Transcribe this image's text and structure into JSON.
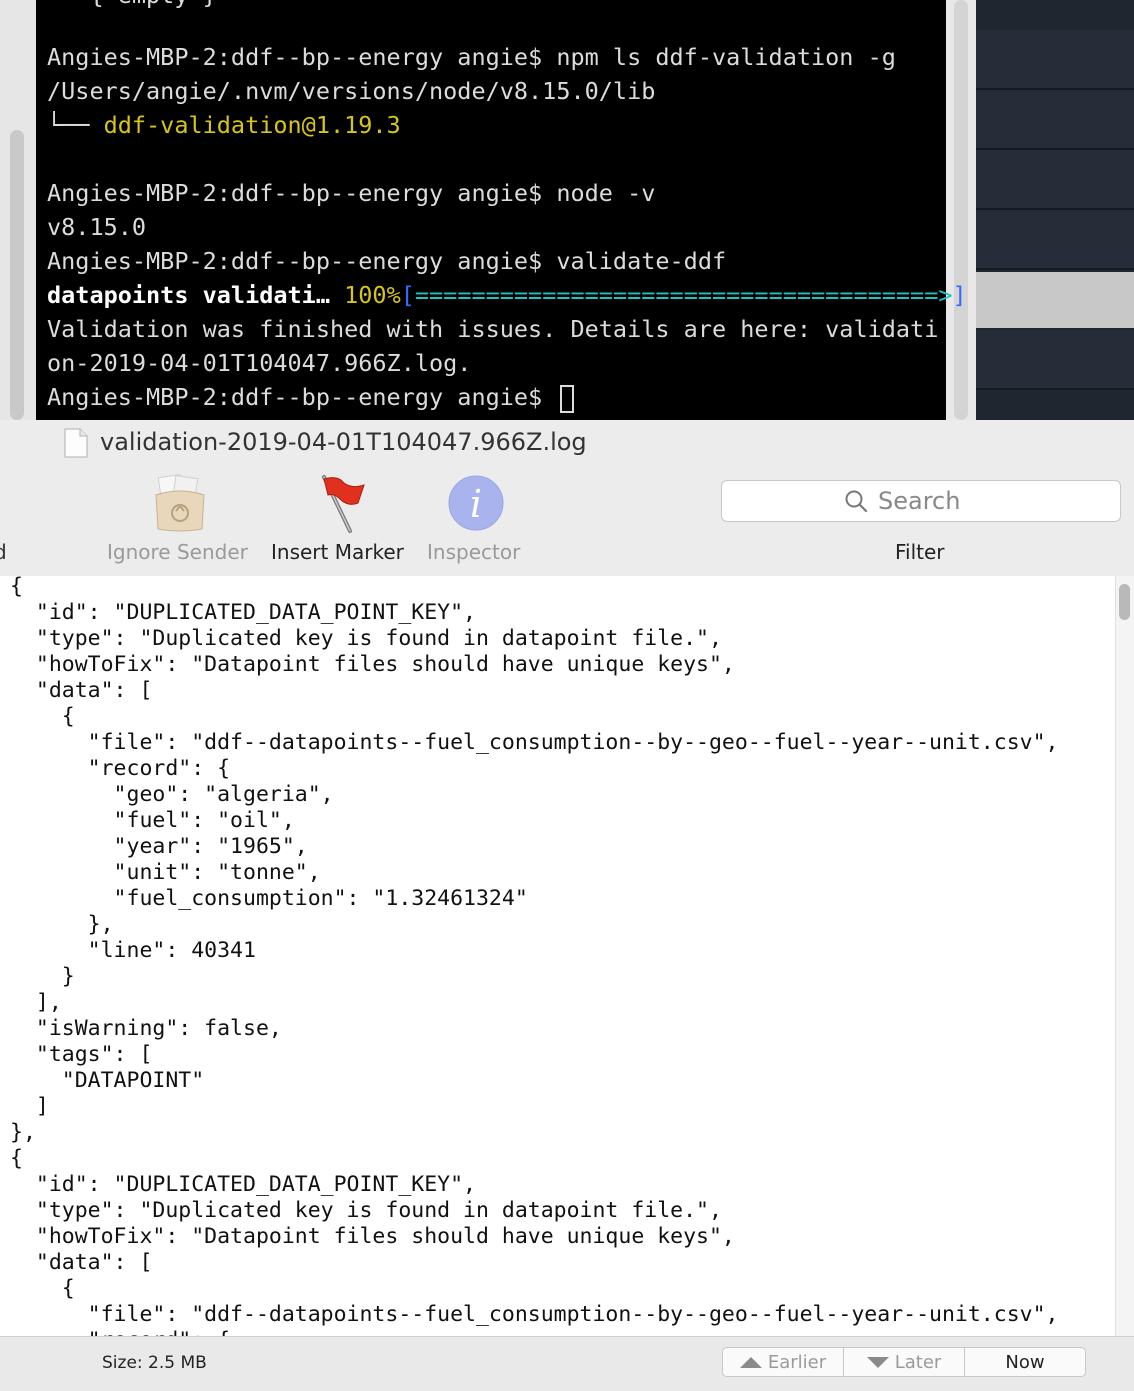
{
  "terminal": {
    "lines": [
      {
        "text": "   { empty }"
      },
      {
        "text": "Angies-MBP-2:ddf--bp--energy angie$ npm ls ddf-validation -g"
      },
      {
        "text": "/Users/angie/.nvm/versions/node/v8.15.0/lib"
      },
      {
        "tree": "└── ",
        "pkg": "ddf-validation@1.19.3"
      },
      {
        "text": "Angies-MBP-2:ddf--bp--energy angie$ node -v"
      },
      {
        "text": "v8.15.0"
      },
      {
        "text": "Angies-MBP-2:ddf--bp--energy angie$ validate-ddf"
      },
      {
        "label": "datapoints validati… ",
        "percent": "100%",
        "bar_open": "[",
        "bar_fill": "=====================================>",
        "bar_close": "]"
      },
      {
        "text": "Validation was finished with issues. Details are here: validati"
      },
      {
        "text": "on-2019-04-01T104047.966Z.log."
      },
      {
        "text": "Angies-MBP-2:ddf--bp--energy angie$ "
      }
    ],
    "progress": 1.0
  },
  "window": {
    "title": "validation-2019-04-01T104047.966Z.log",
    "doc_icon": "document-icon"
  },
  "toolbar": {
    "cut_label": "d",
    "ignore_sender": "Ignore Sender",
    "insert_marker": "Insert Marker",
    "inspector": "Inspector",
    "search_placeholder": "Search",
    "filter": "Filter"
  },
  "log_text": "{\n  \"id\": \"DUPLICATED_DATA_POINT_KEY\",\n  \"type\": \"Duplicated key is found in datapoint file.\",\n  \"howToFix\": \"Datapoint files should have unique keys\",\n  \"data\": [\n    {\n      \"file\": \"ddf--datapoints--fuel_consumption--by--geo--fuel--year--unit.csv\",\n      \"record\": {\n        \"geo\": \"algeria\",\n        \"fuel\": \"oil\",\n        \"year\": \"1965\",\n        \"unit\": \"tonne\",\n        \"fuel_consumption\": \"1.32461324\"\n      },\n      \"line\": 40341\n    }\n  ],\n  \"isWarning\": false,\n  \"tags\": [\n    \"DATAPOINT\"\n  ]\n},\n{\n  \"id\": \"DUPLICATED_DATA_POINT_KEY\",\n  \"type\": \"Duplicated key is found in datapoint file.\",\n  \"howToFix\": \"Datapoint files should have unique keys\",\n  \"data\": [\n    {\n      \"file\": \"ddf--datapoints--fuel_consumption--by--geo--fuel--year--unit.csv\",\n      \"record\": {",
  "status": {
    "size": "Size: 2.5 MB",
    "earlier": "Earlier",
    "later": "Later",
    "now": "Now"
  }
}
